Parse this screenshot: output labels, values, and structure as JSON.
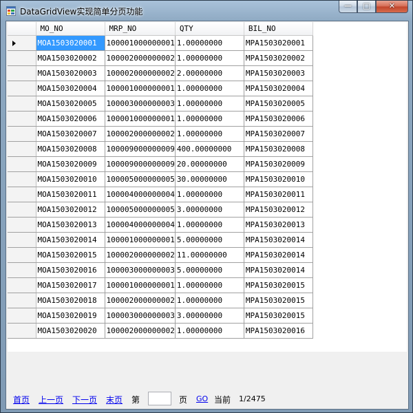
{
  "window": {
    "title": "DataGridView实现简单分页功能",
    "controls": {
      "minimize": "—",
      "maximize": "□",
      "close": "✕"
    }
  },
  "grid": {
    "columns": [
      "MO_NO",
      "MRP_NO",
      "QTY",
      "BIL_NO"
    ],
    "rows": [
      [
        "MOA1503020001",
        "100001000000001",
        "1.00000000",
        "MPA1503020001"
      ],
      [
        "MOA1503020002",
        "100002000000002",
        "1.00000000",
        "MPA1503020002"
      ],
      [
        "MOA1503020003",
        "100002000000002",
        "2.00000000",
        "MPA1503020003"
      ],
      [
        "MOA1503020004",
        "100001000000001",
        "1.00000000",
        "MPA1503020004"
      ],
      [
        "MOA1503020005",
        "100003000000003",
        "1.00000000",
        "MPA1503020005"
      ],
      [
        "MOA1503020006",
        "100001000000001",
        "1.00000000",
        "MPA1503020006"
      ],
      [
        "MOA1503020007",
        "100002000000002",
        "1.00000000",
        "MPA1503020007"
      ],
      [
        "MOA1503020008",
        "100009000000009",
        "400.00000000",
        "MPA1503020008"
      ],
      [
        "MOA1503020009",
        "100009000000009",
        "20.00000000",
        "MPA1503020009"
      ],
      [
        "MOA1503020010",
        "100005000000005",
        "30.00000000",
        "MPA1503020010"
      ],
      [
        "MOA1503020011",
        "100004000000004",
        "1.00000000",
        "MPA1503020011"
      ],
      [
        "MOA1503020012",
        "100005000000005",
        "3.00000000",
        "MPA1503020012"
      ],
      [
        "MOA1503020013",
        "100004000000004",
        "1.00000000",
        "MPA1503020013"
      ],
      [
        "MOA1503020014",
        "100001000000001",
        "5.00000000",
        "MPA1503020014"
      ],
      [
        "MOA1503020015",
        "100002000000002",
        "11.00000000",
        "MPA1503020014"
      ],
      [
        "MOA1503020016",
        "100003000000003",
        "5.00000000",
        "MPA1503020014"
      ],
      [
        "MOA1503020017",
        "100001000000001",
        "1.00000000",
        "MPA1503020015"
      ],
      [
        "MOA1503020018",
        "100002000000002",
        "1.00000000",
        "MPA1503020015"
      ],
      [
        "MOA1503020019",
        "100003000000003",
        "3.00000000",
        "MPA1503020015"
      ],
      [
        "MOA1503020020",
        "100002000000002",
        "1.00000000",
        "MPA1503020016"
      ]
    ]
  },
  "pager": {
    "first": "首页",
    "prev": "上一页",
    "next": "下一页",
    "last": "末页",
    "page_prefix": "第",
    "page_input_value": "",
    "page_suffix": "页",
    "go": "GO",
    "current_label": "当前",
    "current_value": "1/2475"
  },
  "colors": {
    "selection": "#3399ff",
    "link": "#0000ee"
  }
}
